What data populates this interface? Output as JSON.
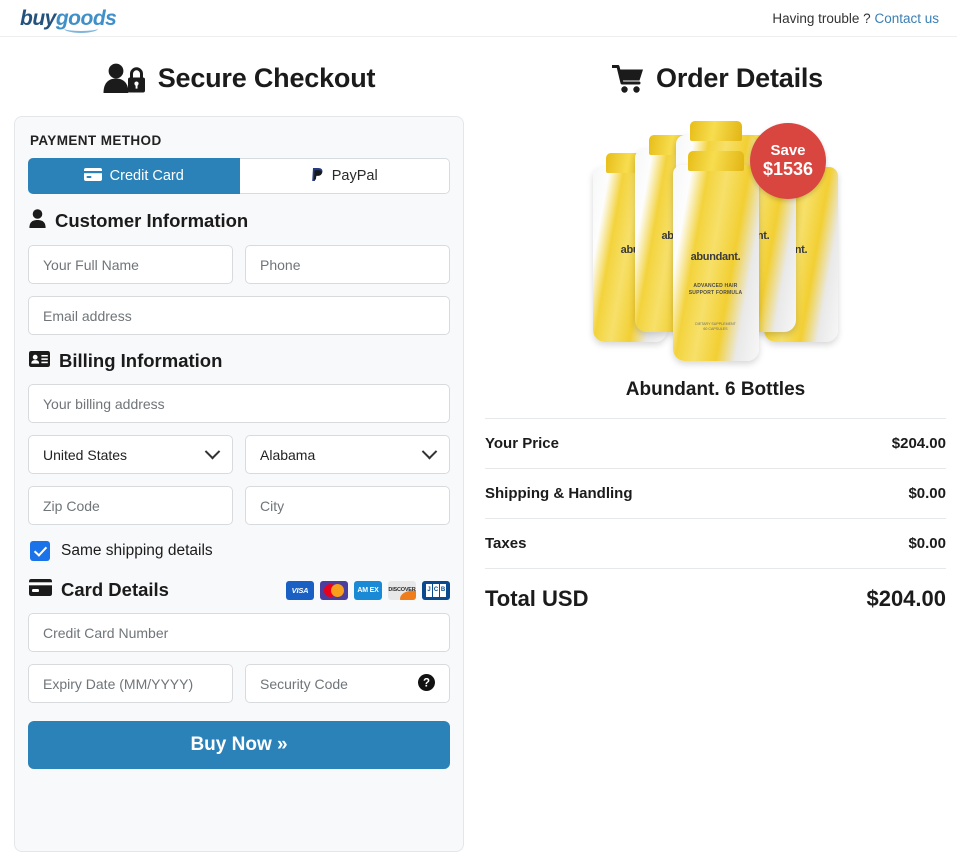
{
  "header": {
    "logo_buy": "buy",
    "logo_goods": "goods",
    "help_text": "Having trouble ?",
    "help_link": "Contact us"
  },
  "left": {
    "title": "Secure Checkout",
    "title_icon": "user-lock-icon",
    "payment_method_label": "PAYMENT METHOD",
    "tabs": [
      {
        "label": "Credit Card",
        "icon": "credit-card-icon",
        "active": true
      },
      {
        "label": "PayPal",
        "icon": "paypal-icon",
        "active": false
      }
    ],
    "customer": {
      "heading": "Customer Information",
      "icon": "user-icon",
      "full_name_placeholder": "Your Full Name",
      "full_name_value": "",
      "phone_placeholder": "Phone",
      "phone_value": "",
      "email_placeholder": "Email address",
      "email_value": ""
    },
    "billing": {
      "heading": "Billing Information",
      "icon": "id-card-icon",
      "address_placeholder": "Your billing address",
      "address_value": "",
      "country_value": "United States",
      "state_value": "Alabama",
      "zip_placeholder": "Zip Code",
      "zip_value": "",
      "city_placeholder": "City",
      "city_value": "",
      "same_shipping_label": "Same shipping details",
      "same_shipping_checked": true
    },
    "card": {
      "heading": "Card Details",
      "icon": "card-icon",
      "accepted": [
        "VISA",
        "Mastercard",
        "AMEX",
        "DISCOVER",
        "JCB"
      ],
      "number_placeholder": "Credit Card Number",
      "number_value": "",
      "expiry_placeholder": "Expiry Date (MM/YYYY)",
      "expiry_value": "",
      "cvv_placeholder": "Security Code",
      "cvv_value": "",
      "cvv_help_icon": "question-circle-icon"
    },
    "buy_button": "Buy Now »"
  },
  "right": {
    "title": "Order Details",
    "title_icon": "shopping-cart-icon",
    "product": {
      "name": "Abundant. 6 Bottles",
      "brand": "abundant.",
      "tagline": "ADVANCED HAIR\nSUPPORT FORMULA",
      "fineprint": "DIETARY SUPPLEMENT\n60 CAPSULES",
      "badge_line1": "Save",
      "badge_line2": "$1536"
    },
    "summary": [
      {
        "label": "Your Price",
        "value": "$204.00"
      },
      {
        "label": "Shipping & Handling",
        "value": "$0.00"
      },
      {
        "label": "Taxes",
        "value": "$0.00"
      }
    ],
    "total": {
      "label": "Total USD",
      "value": "$204.00"
    }
  },
  "colors": {
    "accent_blue": "#2a82b8",
    "link_blue": "#3a7fb5",
    "checkbox_blue": "#1a73e8",
    "badge_red": "#d9453f",
    "panel_bg": "#f8f9fa"
  }
}
